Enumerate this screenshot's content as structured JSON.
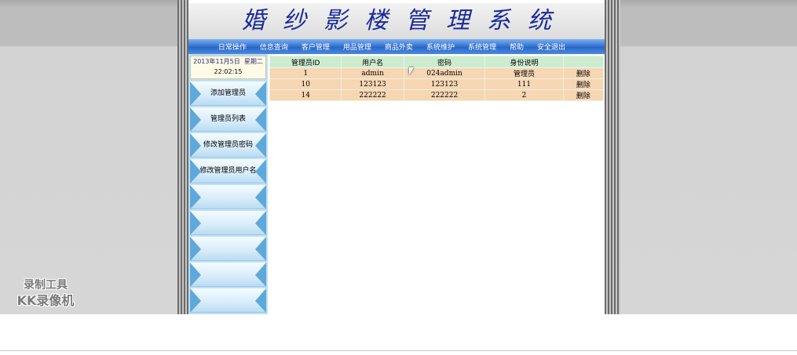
{
  "header": {
    "site_title": "婚纱影楼管理系统"
  },
  "nav": {
    "items": [
      {
        "label": "日常操作"
      },
      {
        "label": "信息查询"
      },
      {
        "label": "客户管理"
      },
      {
        "label": "用品管理"
      },
      {
        "label": "商品外卖"
      },
      {
        "label": "系统维护"
      },
      {
        "label": "系统管理"
      },
      {
        "label": "帮助"
      },
      {
        "label": "安全退出"
      }
    ]
  },
  "clock": {
    "date": "2013年11月5日",
    "weekday": "星期二",
    "time": "22:02:15"
  },
  "sidebar": {
    "items": [
      {
        "label": "添加管理员"
      },
      {
        "label": "管理员列表"
      },
      {
        "label": "修改管理员密码"
      },
      {
        "label": "修改管理员用户名"
      },
      {
        "label": ""
      },
      {
        "label": ""
      },
      {
        "label": ""
      },
      {
        "label": ""
      },
      {
        "label": ""
      }
    ]
  },
  "table": {
    "columns": [
      "管理员ID",
      "用户名",
      "密码",
      "身份说明",
      ""
    ],
    "rows": [
      {
        "id": "1",
        "username": "admin",
        "password": "024admin",
        "role": "管理员",
        "action": "删除"
      },
      {
        "id": "10",
        "username": "123123",
        "password": "123123",
        "role": "111",
        "action": "删除"
      },
      {
        "id": "14",
        "username": "222222",
        "password": "222222",
        "role": "2",
        "action": "删除"
      }
    ]
  },
  "watermark": {
    "line1": "录制工具",
    "line2": "KK录像机"
  },
  "colors": {
    "title": "#1a2a9a",
    "nav_bg": "#2a68c8",
    "header_row": "#cdeccf",
    "data_row": "#f7d6b4",
    "sidebar_bg": "#bfe0f5"
  }
}
